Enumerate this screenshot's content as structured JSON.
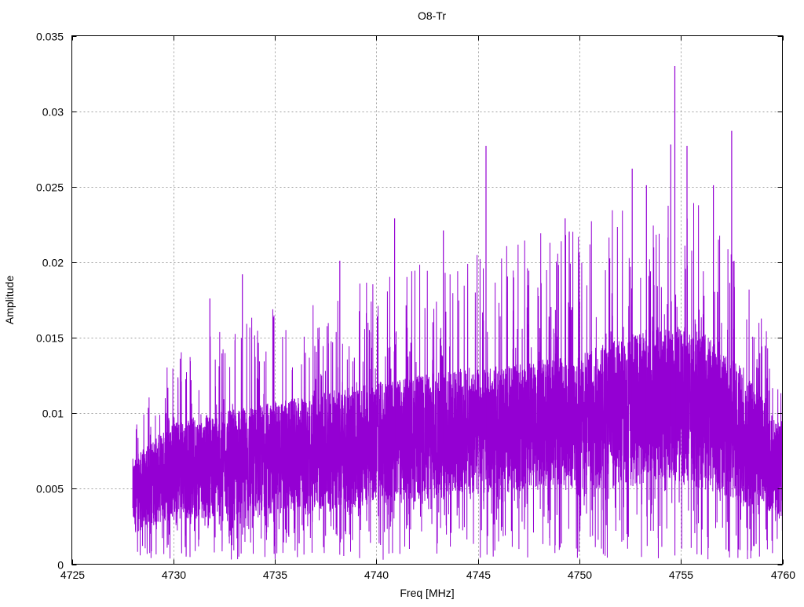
{
  "chart_data": {
    "type": "line",
    "title": "O8-Tr",
    "xlabel": "Freq [MHz]",
    "ylabel": "Amplitude",
    "xlim": [
      4725,
      4760
    ],
    "ylim": [
      0,
      0.035
    ],
    "xticks": [
      "4725",
      "4730",
      "4735",
      "4740",
      "4745",
      "4750",
      "4755",
      "4760"
    ],
    "xtick_values": [
      4725,
      4730,
      4735,
      4740,
      4745,
      4750,
      4755,
      4760
    ],
    "yticks": [
      "0",
      "0.005",
      "0.01",
      "0.015",
      "0.02",
      "0.025",
      "0.03",
      "0.035"
    ],
    "ytick_values": [
      0,
      0.005,
      0.01,
      0.015,
      0.02,
      0.025,
      0.03,
      0.035
    ],
    "grid": true,
    "legend": "none",
    "series": [
      {
        "name": "O8-Tr",
        "color": "#9400d3",
        "x_range": [
          4728,
          4760
        ],
        "envelope": {
          "x": [
            4728,
            4730,
            4732,
            4734,
            4736,
            4738,
            4740,
            4742,
            4744,
            4746,
            4748,
            4750,
            4752,
            4754,
            4756,
            4758,
            4760
          ],
          "band_low": [
            0.002,
            0.003,
            0.003,
            0.003,
            0.0035,
            0.0035,
            0.004,
            0.004,
            0.0045,
            0.0045,
            0.005,
            0.005,
            0.005,
            0.0055,
            0.005,
            0.004,
            0.003
          ],
          "band_high": [
            0.007,
            0.0095,
            0.01,
            0.0105,
            0.011,
            0.0115,
            0.012,
            0.0125,
            0.013,
            0.013,
            0.0135,
            0.014,
            0.015,
            0.016,
            0.0155,
            0.013,
            0.009
          ],
          "spike_max": [
            0.01,
            0.014,
            0.016,
            0.017,
            0.018,
            0.018,
            0.019,
            0.02,
            0.021,
            0.021,
            0.022,
            0.023,
            0.024,
            0.024,
            0.024,
            0.021,
            0.012
          ]
        },
        "peaks": [
          {
            "x": 4731.8,
            "y": 0.0176
          },
          {
            "x": 4733.4,
            "y": 0.0192
          },
          {
            "x": 4738.2,
            "y": 0.0201
          },
          {
            "x": 4740.9,
            "y": 0.0229
          },
          {
            "x": 4743.3,
            "y": 0.0221
          },
          {
            "x": 4745.4,
            "y": 0.0277
          },
          {
            "x": 4749.3,
            "y": 0.0229
          },
          {
            "x": 4752.6,
            "y": 0.0262
          },
          {
            "x": 4753.3,
            "y": 0.0251
          },
          {
            "x": 4754.5,
            "y": 0.0278
          },
          {
            "x": 4754.7,
            "y": 0.033
          },
          {
            "x": 4755.3,
            "y": 0.0277
          },
          {
            "x": 4756.6,
            "y": 0.0251
          },
          {
            "x": 4757.5,
            "y": 0.0287
          }
        ]
      }
    ]
  }
}
